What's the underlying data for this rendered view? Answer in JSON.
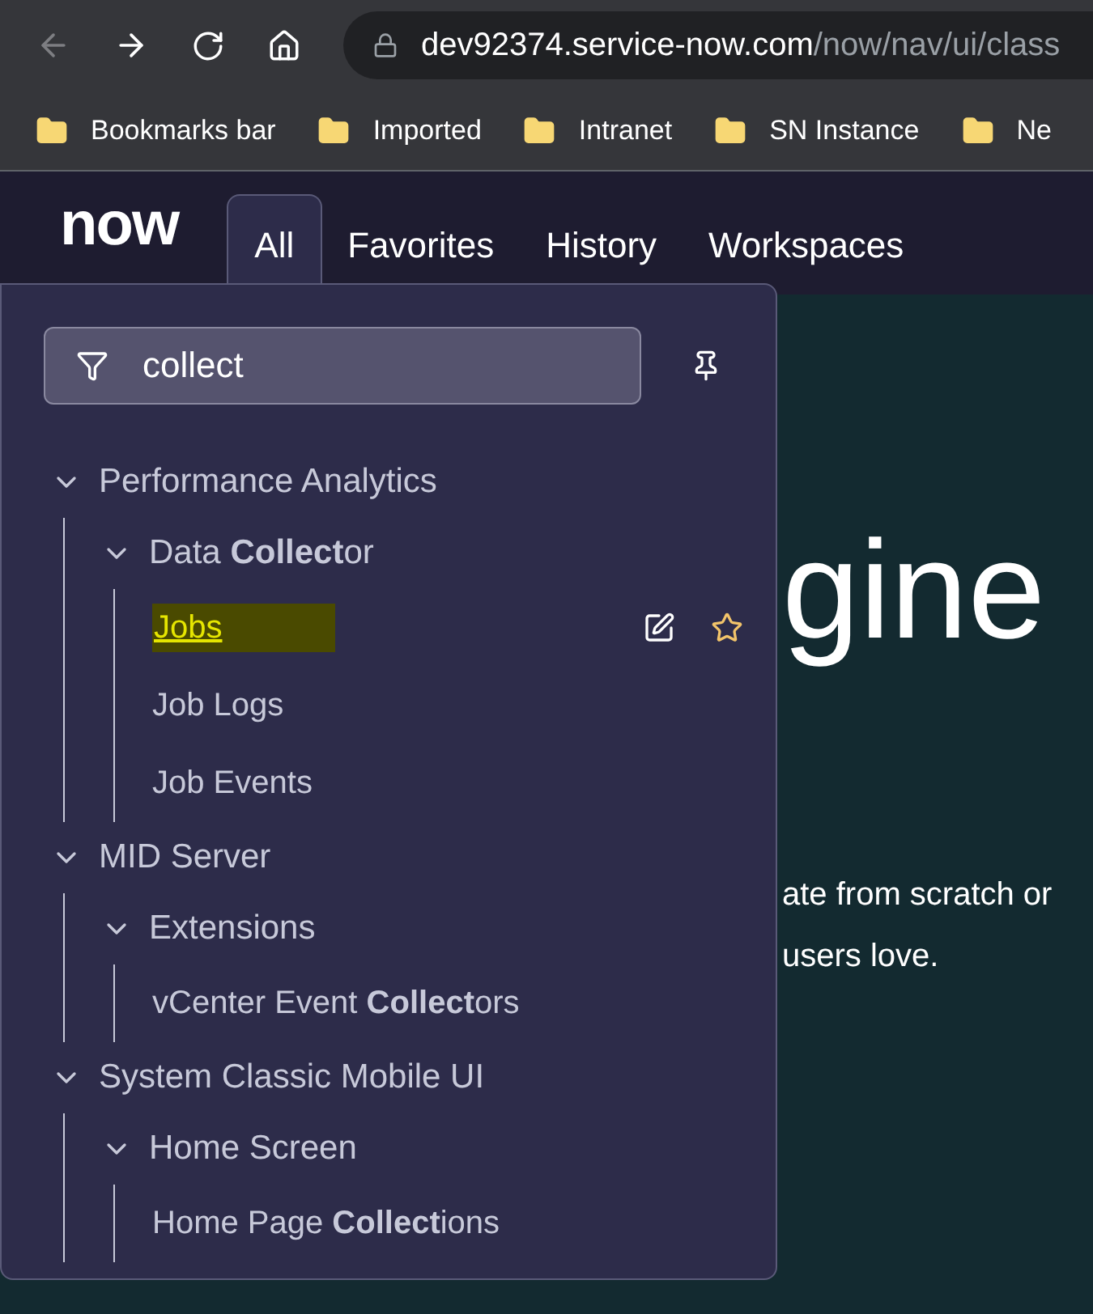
{
  "browser": {
    "back_disabled": true,
    "url_host": "dev92374.service-now.com",
    "url_path": "/now/nav/ui/class",
    "bookmarks": [
      "Bookmarks bar",
      "Imported",
      "Intranet",
      "SN Instance",
      "Ne"
    ]
  },
  "header": {
    "logo": "now",
    "tabs": [
      {
        "label": "All",
        "selected": true
      },
      {
        "label": "Favorites",
        "selected": false
      },
      {
        "label": "History",
        "selected": false
      },
      {
        "label": "Workspaces",
        "selected": false
      }
    ]
  },
  "page": {
    "heading": "gine",
    "lines": [
      "ate from scratch or",
      "users love."
    ]
  },
  "menu": {
    "filter": {
      "value": "collect"
    },
    "tree": [
      {
        "label": "Performance Analytics",
        "expanded": true,
        "children": [
          {
            "label": "Data **Collect**or",
            "expanded": true,
            "children": [
              {
                "label": "Jobs",
                "selected": true
              },
              {
                "label": "Job Logs",
                "selected": false
              },
              {
                "label": "Job Events",
                "selected": false
              }
            ]
          }
        ]
      },
      {
        "label": "MID Server",
        "expanded": true,
        "children": [
          {
            "label": "Extensions",
            "expanded": true,
            "children": [
              {
                "label": "vCenter Event **Collect**ors",
                "selected": false
              }
            ]
          }
        ]
      },
      {
        "label": "System Classic Mobile UI",
        "expanded": true,
        "children": [
          {
            "label": "Home Screen",
            "expanded": true,
            "children": [
              {
                "label": "Home Page **Collect**ions",
                "selected": false
              }
            ]
          }
        ]
      }
    ]
  }
}
